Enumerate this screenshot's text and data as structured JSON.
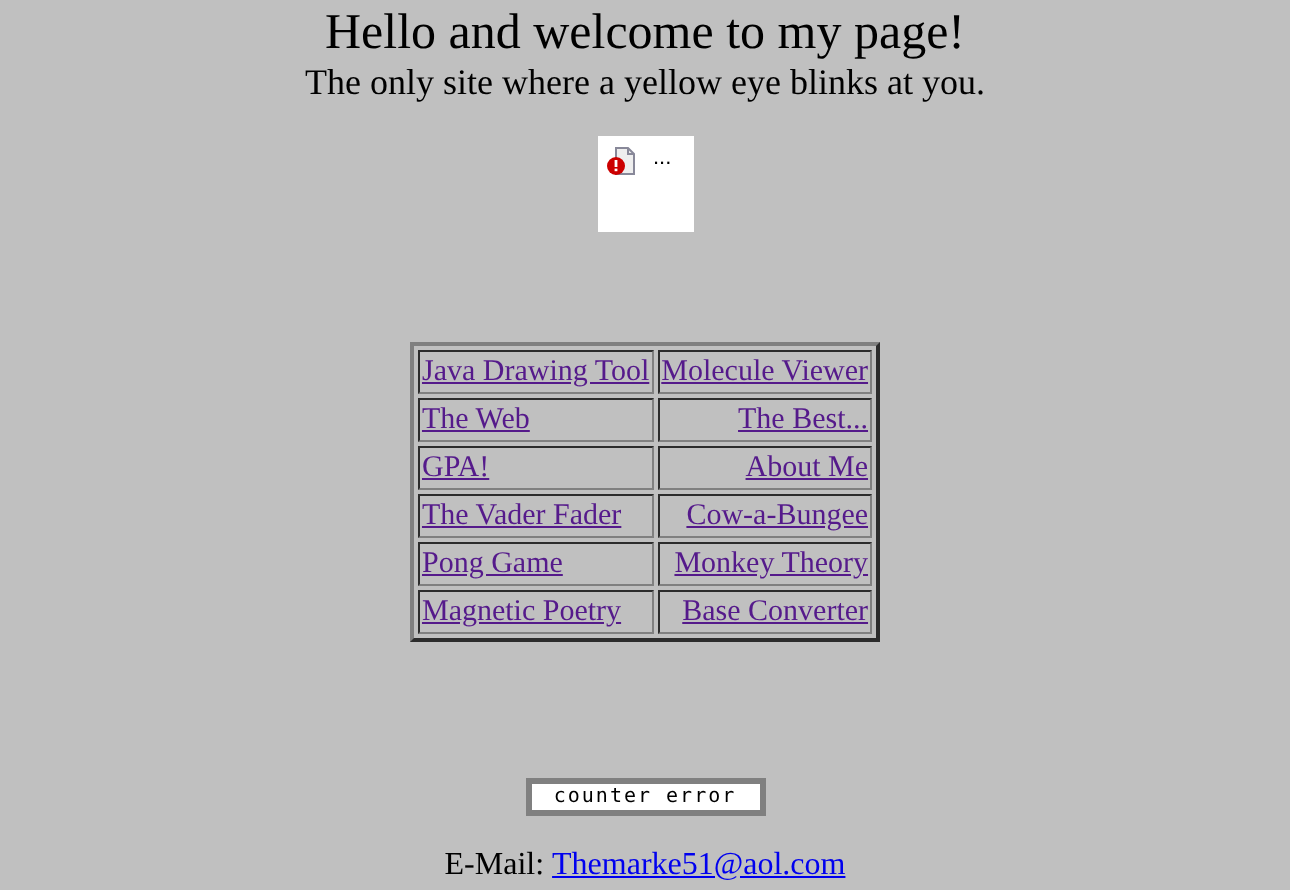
{
  "heading": "Hello and welcome to my page!",
  "subheading": "The only site where a yellow eye blinks at you.",
  "image": {
    "broken": true,
    "alt": "..."
  },
  "links_table": {
    "rows": [
      [
        {
          "label": "Java Drawing Tool",
          "visited": true
        },
        {
          "label": "Molecule Viewer",
          "visited": true
        }
      ],
      [
        {
          "label": "The Web",
          "visited": true
        },
        {
          "label": "The Best...",
          "visited": true
        }
      ],
      [
        {
          "label": "GPA!",
          "visited": true
        },
        {
          "label": "About Me",
          "visited": true
        }
      ],
      [
        {
          "label": "The Vader Fader",
          "visited": true
        },
        {
          "label": "Cow-a-Bungee",
          "visited": true
        }
      ],
      [
        {
          "label": "Pong Game",
          "visited": true
        },
        {
          "label": "Monkey Theory",
          "visited": true
        }
      ],
      [
        {
          "label": "Magnetic Poetry",
          "visited": true
        },
        {
          "label": "Base Converter",
          "visited": true
        }
      ]
    ]
  },
  "counter": "counter error",
  "footer": {
    "label": "E-Mail:",
    "email": {
      "label": "Themarke51@aol.com",
      "visited": false
    }
  }
}
